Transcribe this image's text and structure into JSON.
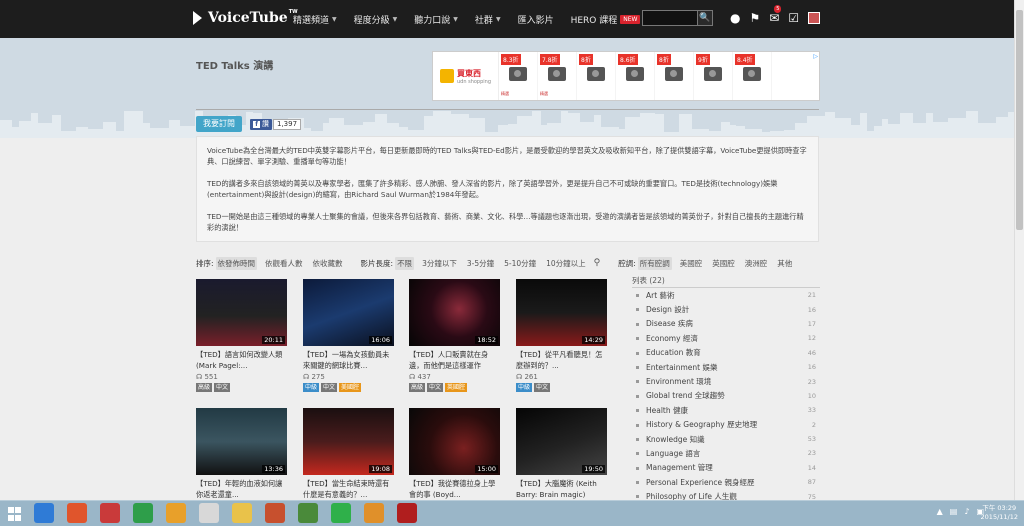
{
  "nav": {
    "logo_text": "VoiceTube",
    "logo_tm": "TW",
    "items": [
      {
        "label": "精選頻道",
        "dropdown": true
      },
      {
        "label": "程度分級",
        "dropdown": true
      },
      {
        "label": "聽力口說",
        "dropdown": true
      },
      {
        "label": "社群",
        "dropdown": true
      },
      {
        "label": "匯入影片",
        "dropdown": false
      },
      {
        "label": "HERO 課程",
        "dropdown": false,
        "badge": "NEW"
      }
    ],
    "search_placeholder": "",
    "search_icon": "🔍",
    "notification_count": "5"
  },
  "page": {
    "title": "TED Talks 演講",
    "subscribe_label": "我要訂閱",
    "fb_label": "讚",
    "fb_count": "1,397",
    "intro": [
      "VoiceTube為全台灣最大的TED中英雙字幕影片平台，每日更新最即時的TED Talks與TED-Ed影片，是最受歡迎的學習英文及吸收新知平台，除了提供雙語字幕，VoiceTube更提供即時查字典、口說練習、單字測驗、重播單句等功能！",
      "TED的講者多來自該領域的菁英以及專家學者，匯集了許多精彩、感人肺腑、發人深省的影片，除了英語學習外，更是提升自己不可或缺的重要窗口。TED是技術(technology)娛樂(entertainment)與設計(design)的縮寫，由Richard Saul Wurman於1984年發起。",
      "TED一開始是由這三種領域的專業人士聚集的會議，但後來各界包括教育、藝術、商業、文化、科學…等議題也逐漸出現，受邀的演講者皆是該領域的菁英份子，針對自己擅長的主題進行精彩的演說！"
    ]
  },
  "ad": {
    "brand": "買東西",
    "brand_sub": "udn shopping",
    "discounts": [
      "8.3折",
      "7.8折",
      "8折",
      "8.6折",
      "8折",
      "9折",
      "8.4折"
    ],
    "tag": "精選",
    "close": "▷"
  },
  "filters": {
    "sort_label": "排序:",
    "sort_options": [
      "依發佈時間",
      "依觀看人數",
      "依收藏數"
    ],
    "sort_selected": 0,
    "length_label": "影片長度:",
    "length_options": [
      "不限",
      "3分鐘以下",
      "3-5分鐘",
      "5-10分鐘",
      "10分鐘以上"
    ],
    "length_selected": 0,
    "accent_label": "腔調:",
    "accent_options": [
      "所有腔調",
      "美國腔",
      "英國腔",
      "澳洲腔",
      "其他"
    ],
    "accent_selected": 0
  },
  "videos": [
    {
      "title": "【TED】語言如何改變人類 (Mark Pagel:...",
      "duration": "20:11",
      "views": "551",
      "tags": [
        {
          "text": "高級",
          "color": "gray"
        },
        {
          "text": "中文",
          "color": "gray"
        }
      ]
    },
    {
      "title": "【TED】一場為女孩動員未來關鍵的網球比賽...",
      "duration": "16:06",
      "views": "275",
      "tags": [
        {
          "text": "中級",
          "color": "blue"
        },
        {
          "text": "中文",
          "color": "gray"
        },
        {
          "text": "美國腔",
          "color": "orange"
        }
      ]
    },
    {
      "title": "【TED】人口販賣就在身邊，而他們是這樣運作",
      "duration": "18:52",
      "views": "437",
      "tags": [
        {
          "text": "高級",
          "color": "gray"
        },
        {
          "text": "中文",
          "color": "gray"
        },
        {
          "text": "英國腔",
          "color": "orange"
        }
      ]
    },
    {
      "title": "【TED】從平凡看聽見！怎麼辦到的？...",
      "duration": "14:29",
      "views": "261",
      "tags": [
        {
          "text": "中級",
          "color": "blue"
        },
        {
          "text": "中文",
          "color": "gray"
        }
      ]
    },
    {
      "title": "【TED】年輕的血液如何讓你返老還童...",
      "duration": "13:36",
      "views": "",
      "tags": []
    },
    {
      "title": "【TED】當生命結束時還有什麼是有意義的？...",
      "duration": "19:08",
      "views": "",
      "tags": []
    },
    {
      "title": "【TED】我從賽德拉身上學會的事 (Boyd...",
      "duration": "15:00",
      "views": "",
      "tags": []
    },
    {
      "title": "【TED】大腦魔術 (Keith Barry: Brain magic)",
      "duration": "19:50",
      "views": "",
      "tags": []
    }
  ],
  "categories": {
    "header": "列表 (22)",
    "items": [
      {
        "label": "Art 藝術",
        "count": "21"
      },
      {
        "label": "Design 設計",
        "count": "16"
      },
      {
        "label": "Disease 疾病",
        "count": "17"
      },
      {
        "label": "Economy 經濟",
        "count": "12"
      },
      {
        "label": "Education 教育",
        "count": "46"
      },
      {
        "label": "Entertainment 娛樂",
        "count": "16"
      },
      {
        "label": "Environment 環境",
        "count": "23"
      },
      {
        "label": "Global trend 全球趨勢",
        "count": "10"
      },
      {
        "label": "Health 健康",
        "count": "33"
      },
      {
        "label": "History & Geography 歷史地理",
        "count": "2"
      },
      {
        "label": "Knowledge 知識",
        "count": "53"
      },
      {
        "label": "Language 語言",
        "count": "23"
      },
      {
        "label": "Management 管理",
        "count": "14"
      },
      {
        "label": "Personal Experience 親身經歷",
        "count": "87"
      },
      {
        "label": "Philosophy of Life 人生觀",
        "count": "75"
      }
    ]
  },
  "taskbar": {
    "clock_time": "下午 03:29",
    "clock_date": "2015/11/12"
  },
  "colors": {
    "nav_bg": "#1d1d1d",
    "accent_blue": "#42a5c9",
    "new_badge": "#d9232d"
  }
}
